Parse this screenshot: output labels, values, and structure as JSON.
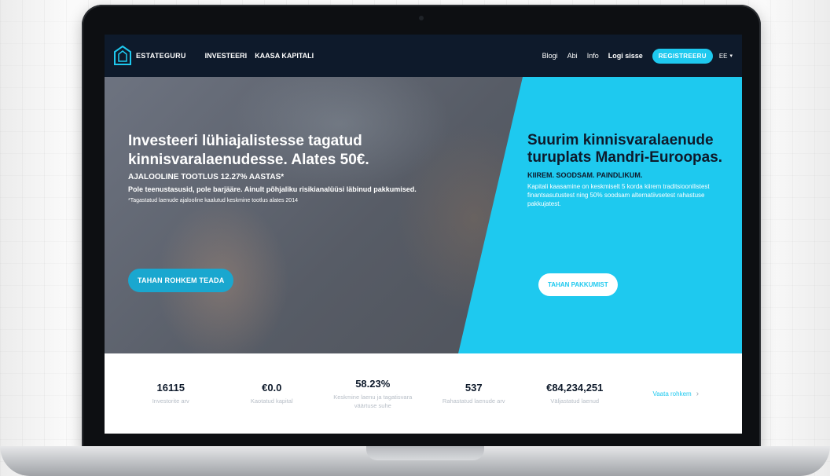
{
  "nav": {
    "logo_text": "ESTATEGURU",
    "links": [
      "INVESTEERI",
      "KAASA KAPITALI"
    ],
    "right_links": [
      "Blogi",
      "Abi",
      "Info"
    ],
    "login": "Logi sisse",
    "register": "REGISTREERU",
    "language": "EE"
  },
  "hero": {
    "left": {
      "title_line1": "Investeeri lühiajalistesse tagatud",
      "title_line2": "kinnisvaralaenudesse. Alates 50€.",
      "subtitle": "AJALOOLINE TOOTLUS 12.27% AASTAS*",
      "description": "Pole teenustasusid, pole barjääre. Ainult põhjaliku risikianalüüsi läbinud pakkumised.",
      "footnote": "*Tagastatud laenude ajalooline kaalutud keskmine tootlus alates 2014",
      "button": "TAHAN ROHKEM TEADA"
    },
    "right": {
      "title_line1": "Suurim kinnisvaralaenude",
      "title_line2": "turuplats Mandri-Euroopas.",
      "subtitle": "KIIREM. SOODSAM. PAINDLIKUM.",
      "description": "Kapitali kaasamine on keskmiselt 5 korda kiirem traditsioonilistest finantsasutustest ning 50% soodsam alternatiivsetest rahastuse pakkujatest.",
      "button": "TAHAN PAKKUMIST"
    }
  },
  "stats": [
    {
      "value": "16115",
      "label": "Investorite arv"
    },
    {
      "value": "€0.0",
      "label": "Kaotatud kapital"
    },
    {
      "value": "58.23%",
      "label": "Keskmine laenu ja tagatisvara väärtuse suhe"
    },
    {
      "value": "537",
      "label": "Rahastatud laenude arv"
    },
    {
      "value": "€84,234,251",
      "label": "Väljastatud laenud"
    }
  ],
  "stats_link": "Vaata rohkem",
  "colors": {
    "navy": "#0e1a2b",
    "accent": "#1ec9ef",
    "muted": "#b6bdc6"
  }
}
